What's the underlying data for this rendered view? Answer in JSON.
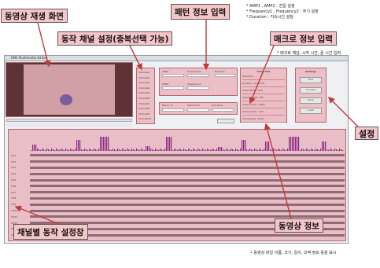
{
  "callouts": {
    "video_screen": "동영상 재생 화면",
    "pattern_input": "패턴 정보 입력",
    "channel_setting": "동작 채널 설정(중복선택 가능)",
    "macro_input": "매크로 정보 입력",
    "settings": "설정",
    "video_info": "동영상 정보",
    "channel_editor": "채널별 동작 설정창"
  },
  "notes": {
    "pattern_line1": "* AMP1 , AMP2 : 전압 설정",
    "pattern_line2": "* Frequency1 , Frequency2 : 주기 설정",
    "pattern_line3": "* Duration : 지속시간 설정",
    "macro_note": "* 매크로 채널, 시작 시간, 끝 시간 입력",
    "video_info_note": "• 동영상 파일 이름, 크기, 길이, 코덱 정보 등을 표시"
  },
  "screenshot": {
    "window_title": "KMS Multimedia Editor",
    "channels": [
      "Channel1",
      "Channel2",
      "Channel3",
      "Channel4",
      "Channel5",
      "Channel6",
      "Channel7",
      "Channel8",
      "Channel9",
      "Channel10"
    ],
    "pattern_labels": [
      "AMP1",
      "Frequency1",
      "Duration",
      "AMP2",
      "Frequency2"
    ],
    "macro_labels": [
      "Macro ch",
      "Start Time",
      "End Time"
    ],
    "video_info_title": "Video Info",
    "video_info_rows": [
      "Filename: ...",
      "Duration: 00:00:52",
      "Video Width: 640",
      "Video Height: 480",
      "Video Codec: H264",
      "Audio Codec: AAC",
      "Frame Rate: 29.97"
    ],
    "settings_title": "Settings",
    "settings_buttons": [
      "Port",
      "Connect",
      "Save",
      "Load"
    ],
    "track_labels": [
      "CH1",
      "CH2",
      "CH3",
      "CH4",
      "CH5",
      "CH6",
      "CH7",
      "CH8",
      "CH9",
      "CH10",
      "CH11",
      "CH12",
      "CH13",
      "CH14"
    ]
  },
  "colors": {
    "highlight": "#eb96a0",
    "callout_fill": "#f6c5c9",
    "arrow": "#c03a3a"
  }
}
